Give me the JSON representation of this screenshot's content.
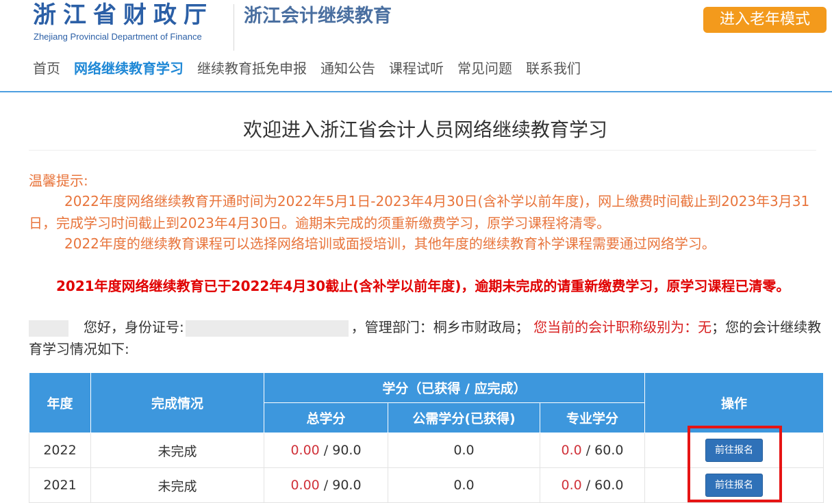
{
  "header": {
    "logo_title": "浙江省财政厅",
    "logo_subtitle": "Zhejiang Provincial Department of Finance",
    "site_title": "浙江会计继续教育",
    "elder_mode_label": "进入老年模式"
  },
  "nav": {
    "items": [
      {
        "label": "首页"
      },
      {
        "label": "网络继续教育学习"
      },
      {
        "label": "继续教育抵免申报"
      },
      {
        "label": "通知公告"
      },
      {
        "label": "课程试听"
      },
      {
        "label": "常见问题"
      },
      {
        "label": "联系我们"
      }
    ]
  },
  "main": {
    "welcome_title": "欢迎进入浙江省会计人员网络继续教育学习",
    "notice_label": "温馨提示:",
    "notice_p1": "2022年度网络继续教育开通时间为2022年5月1日-2023年4月30日(含补学以前年度)，网上缴费时间截止到2023年3月31日，完成学习时间截止到2023年4月30日。逾期未完成的须重新缴费学习，原学习课程将清零。",
    "notice_p2": "2022年度的继续教育课程可以选择网络培训或面授培训，其他年度的继续教育补学课程需要通过网络学习。",
    "alert": "2021年度网络继续教育已于2022年4月30截止(含补学以前年度)，逾期未完成的请重新缴费学习，原学习课程已清零。",
    "info_greeting": "您好，身份证号:",
    "info_dept": "，管理部门：桐乡市财政局；",
    "info_level": "您当前的会计职称级别为：无",
    "info_tail": "；您的会计继续教育学习情况如下:"
  },
  "table": {
    "headers": {
      "year": "年度",
      "status": "完成情况",
      "credits_group": "学分（已获得 / 应完成）",
      "total": "总学分",
      "public": "公需学分(已获得)",
      "professional": "专业学分",
      "action": "操作"
    },
    "rows": [
      {
        "year": "2022",
        "status": "未完成",
        "total_got": "0.00",
        "total_need": " / 90.0",
        "public": "0.0",
        "prof_got": "0.0",
        "prof_need": " / 60.0",
        "action": "前往报名"
      },
      {
        "year": "2021",
        "status": "未完成",
        "total_got": "0.00",
        "total_need": " / 90.0",
        "public": "0.0",
        "prof_got": "0.0",
        "prof_need": " / 60.0",
        "action": "前往报名"
      }
    ]
  },
  "colors": {
    "brand_blue": "#2b5fa6",
    "nav_active": "#1f88d6",
    "elder_button": "#f39a1c",
    "notice_orange": "#e8743b",
    "alert_red": "#e00000",
    "table_header": "#3d97dd",
    "action_button": "#2f71b8",
    "highlight_box": "#e61414"
  }
}
